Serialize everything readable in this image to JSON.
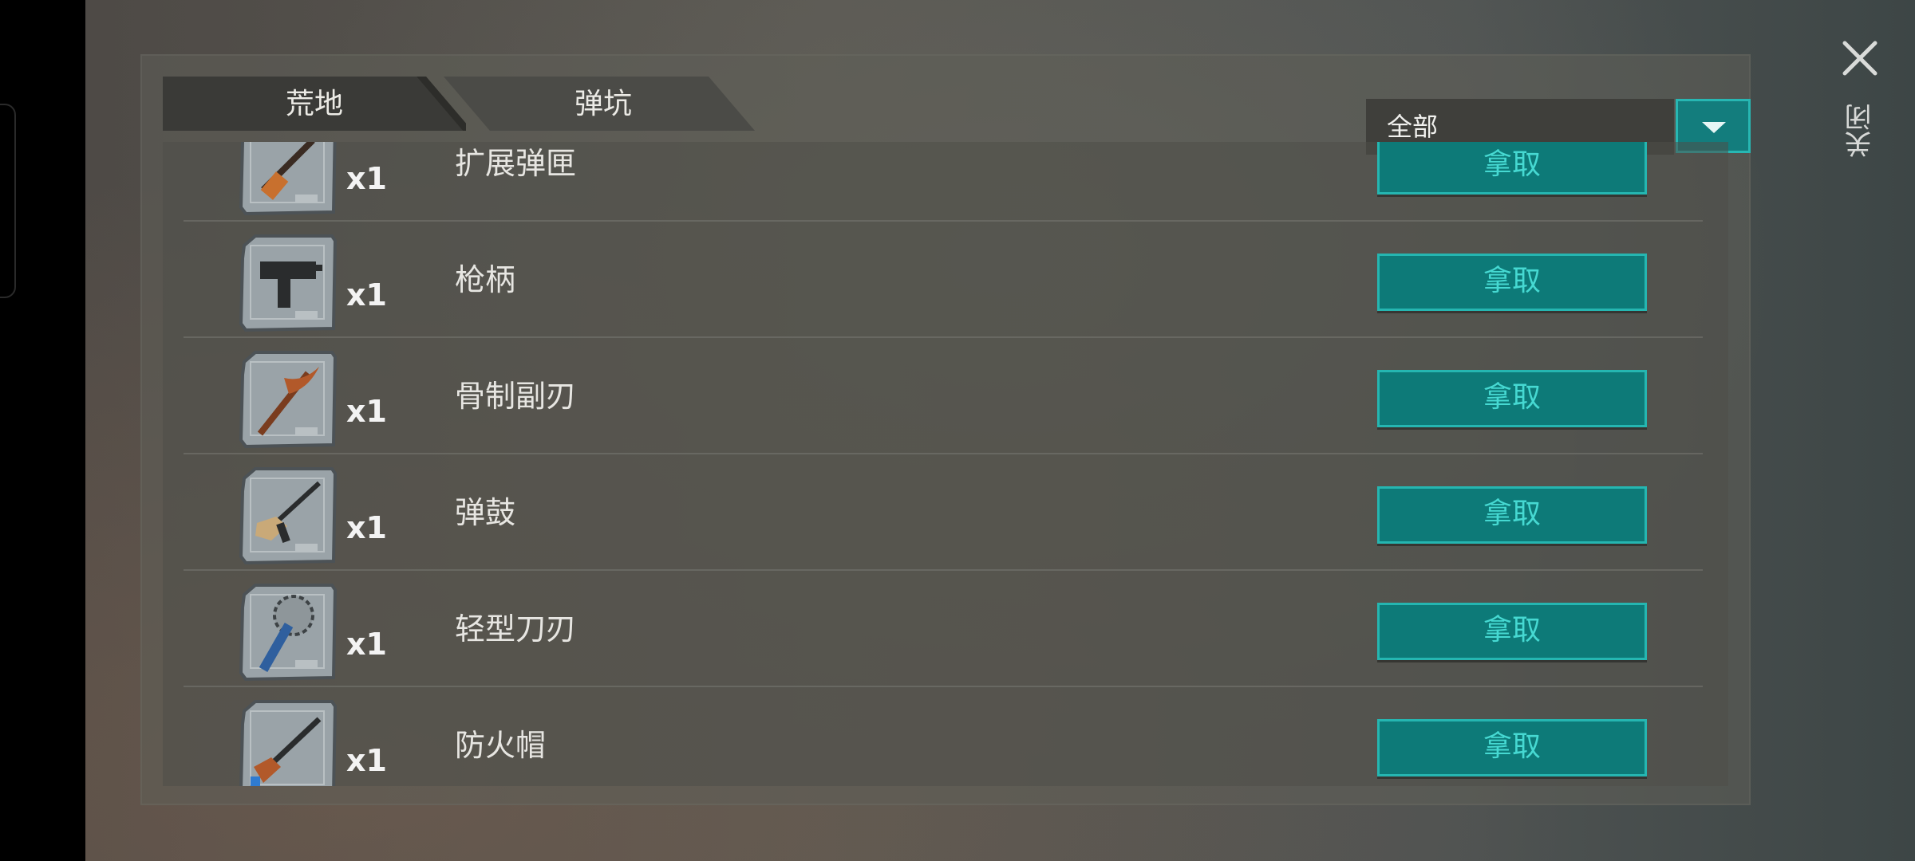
{
  "close": {
    "label": "关闭",
    "icon": "close-icon"
  },
  "tabs": [
    {
      "label": "荒地",
      "active": true
    },
    {
      "label": "弹坑",
      "active": false
    }
  ],
  "filter": {
    "selected": "全部",
    "icon": "dropdown-arrow-icon"
  },
  "items": [
    {
      "name": "扩展弹匣",
      "qty": "x1",
      "icon": "sniper-rifle-blueprint-icon",
      "action": "拿取"
    },
    {
      "name": "枪柄",
      "qty": "x1",
      "icon": "uzi-blueprint-icon",
      "action": "拿取"
    },
    {
      "name": "骨制副刃",
      "qty": "x1",
      "icon": "pickaxe-blueprint-icon",
      "action": "拿取"
    },
    {
      "name": "弹鼓",
      "qty": "x1",
      "icon": "assault-rifle-blueprint-icon",
      "action": "拿取"
    },
    {
      "name": "轻型刀刃",
      "qty": "x1",
      "icon": "saw-mace-blueprint-icon",
      "action": "拿取"
    },
    {
      "name": "防火帽",
      "qty": "x1",
      "icon": "ak-rifle-blueprint-icon",
      "action": "拿取"
    }
  ],
  "colors": {
    "accent": "#0d7a78",
    "accent_border": "#25b6b1",
    "accent_text": "#46d9d2"
  }
}
